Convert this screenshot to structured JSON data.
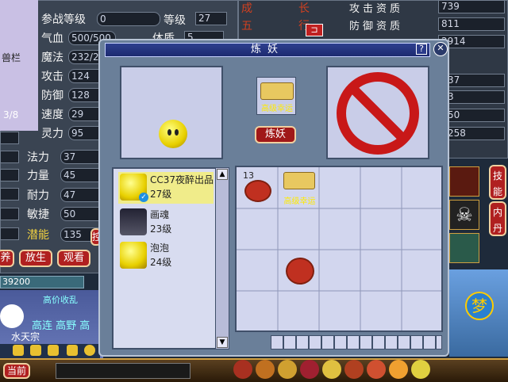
{
  "background_panel": {
    "left_partial_label": "兽栏",
    "page_counter": "3/8",
    "stats": [
      {
        "label": "参战等级",
        "value": "0"
      },
      {
        "label": "气血",
        "value": "500/500"
      },
      {
        "label": "魔法",
        "value": "232/2"
      },
      {
        "label": "攻击",
        "value": "124"
      },
      {
        "label": "防御",
        "value": "128"
      },
      {
        "label": "速度",
        "value": "29"
      },
      {
        "label": "灵力",
        "value": "95"
      }
    ],
    "level_label": "等级",
    "level_value": "27",
    "stat_partial_label": "体质",
    "stat_partial_value": "5",
    "attr_rows": [
      {
        "label": "法力",
        "value": "37"
      },
      {
        "label": "力量",
        "value": "45"
      },
      {
        "label": "耐力",
        "value": "47"
      },
      {
        "label": "敏捷",
        "value": "50"
      },
      {
        "label": "潜能",
        "value": "135"
      }
    ],
    "growth_labels": [
      "成",
      "长",
      "五",
      "行"
    ],
    "aptitudes": [
      {
        "label": "攻击资质",
        "value": "739"
      },
      {
        "label": "防御资质",
        "value": "811"
      },
      {
        "value": "2914"
      },
      {
        "value": "37"
      },
      {
        "value": "3"
      },
      {
        "value": "50"
      },
      {
        "value": "258"
      }
    ],
    "action_buttons": [
      "养",
      "放生",
      "观看",
      "控"
    ],
    "exp_value": "39200",
    "skill_tabs": [
      "技能",
      "内丹"
    ],
    "chat_line_1": "高连 高野 高",
    "chat_line_2": "水天宗",
    "chat_partial": "高价收乱"
  },
  "dialog": {
    "title": "炼妖",
    "help_button": "?",
    "close_button": "✕",
    "item_label": "高级幸运",
    "refine_button": "炼妖",
    "pets": [
      {
        "name": "CC37夜醉出品",
        "level": "27级",
        "selected": true
      },
      {
        "name": "画魂",
        "level": "23级",
        "selected": false
      },
      {
        "name": "泡泡",
        "level": "24级",
        "selected": false
      }
    ],
    "inventory": {
      "slot1_count": "13",
      "slot2_label": "高级幸运"
    }
  },
  "bottom_bar": {
    "current_channel": "当前"
  }
}
